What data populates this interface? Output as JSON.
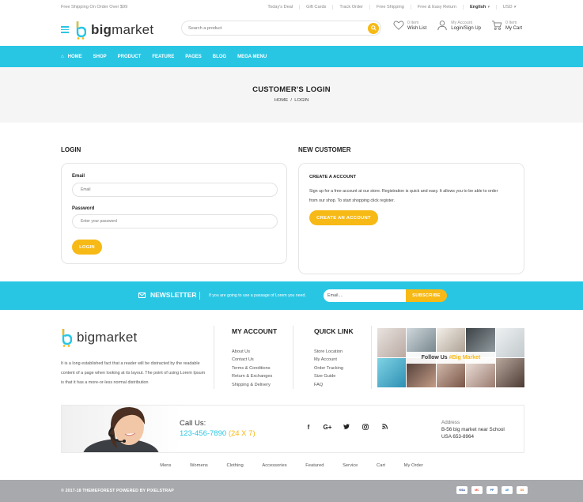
{
  "topbar": {
    "shipping": "Free Shipping On Order Over $99",
    "links": [
      "Today's Deal",
      "Gift Cards",
      "Track Order",
      "Free Shipping",
      "Free & Easy Return"
    ],
    "language": "English",
    "currency": "USD"
  },
  "header": {
    "logo_prefix": "big",
    "logo_suffix": "market",
    "search_placeholder": "Search a product",
    "wishlist": {
      "count": "0 Item",
      "label": "Wish List"
    },
    "account": {
      "title": "My Account",
      "label": "Login/Sign Up"
    },
    "cart": {
      "count": "0 Item",
      "label": "My Cart"
    }
  },
  "nav": {
    "items": [
      "HOME",
      "SHOP",
      "PRODUCT",
      "FEATURE",
      "PAGES",
      "BLOG",
      "MEGA MENU"
    ]
  },
  "banner": {
    "title": "CUSTOMER'S LOGIN",
    "breadcrumb_home": "HOME",
    "breadcrumb_sep": "/",
    "breadcrumb_current": "LOGIN"
  },
  "login": {
    "title": "LOGIN",
    "email_label": "Email",
    "email_placeholder": "Email",
    "password_label": "Password",
    "password_placeholder": "Enter your password",
    "button": "LOGIN"
  },
  "new_customer": {
    "title": "NEW CUSTOMER",
    "heading": "CREATE A ACCOUNT",
    "text": "Sign up for a free account at our store. Registration is quick and easy. It allows you to be able to order from our shop. To start shopping click register.",
    "button": "CREATE AN ACCOUNT"
  },
  "newsletter": {
    "title": "NEWSLETTER",
    "text": "If you are going to use a passage of Lorem you need.",
    "placeholder": "Email....",
    "button": "SUBSCRIBE"
  },
  "footer": {
    "about": "It is a long established fact that a reader will be distracted by the readable content of a page when looking at its layout. The point of using Lorem Ipsum is that it has a more-or-less normal distribution",
    "my_account": {
      "title": "MY ACCOUNT",
      "items": [
        "About Us",
        "Contact Us",
        "Terms & Conditions",
        "Return & Exchanges",
        "Shipping & Delivery"
      ]
    },
    "quick_link": {
      "title": "QUICK LINK",
      "items": [
        "Store Location",
        "My Account",
        "Order Tracking",
        "Size Guide",
        "FAQ"
      ]
    },
    "follow_prefix": "Follow Us",
    "follow_tag": "#Big Market",
    "call_label": "Call Us:",
    "phone": "123-456-7890",
    "phone_hours": "(24 X 7)",
    "social": [
      "f",
      "G+",
      "twitter-icon",
      "instagram-icon",
      "rss-icon"
    ],
    "address_label": "Address",
    "address_line1": "B-56 big market near School",
    "address_line2": "USA 653-8964",
    "links": [
      "Mens",
      "Womens",
      "Clothing",
      "Accessories",
      "Featured",
      "Service",
      "Cart",
      "My Order"
    ],
    "copyright": "© 2017-18 THEMEFOREST POWERED BY PIXELSTRAP",
    "payments": [
      "VISA",
      "MC",
      "PP",
      "AE",
      "DS"
    ]
  },
  "colors": {
    "accent": "#29c6e4",
    "button": "#f7b915",
    "footer_bar": "#a7a9ac"
  }
}
